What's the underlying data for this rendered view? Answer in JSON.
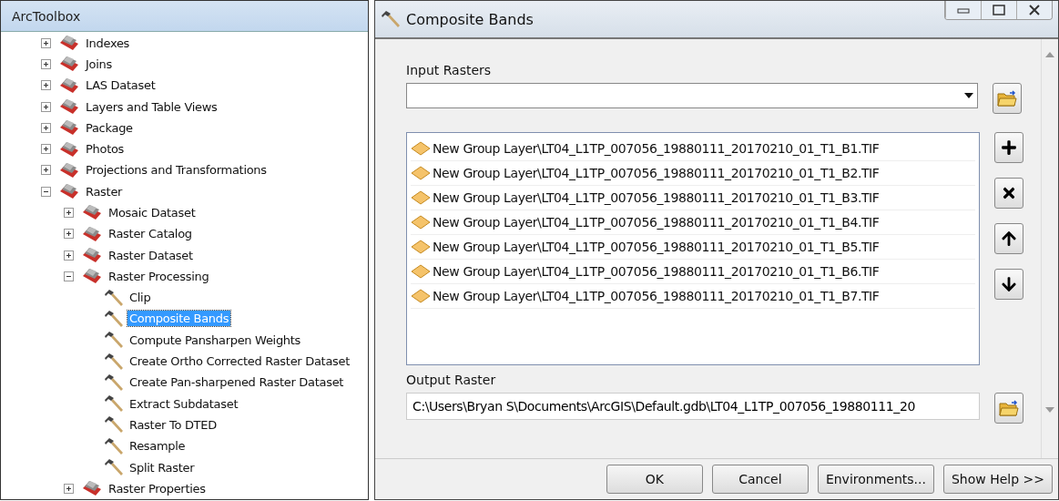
{
  "toolbox": {
    "title": "ArcToolbox",
    "items": [
      {
        "kind": "toolset",
        "label": "Indexes",
        "expanded": false
      },
      {
        "kind": "toolset",
        "label": "Joins",
        "expanded": false
      },
      {
        "kind": "toolset",
        "label": "LAS Dataset",
        "expanded": false
      },
      {
        "kind": "toolset",
        "label": "Layers and Table Views",
        "expanded": false
      },
      {
        "kind": "toolset",
        "label": "Package",
        "expanded": false
      },
      {
        "kind": "toolset",
        "label": "Photos",
        "expanded": false
      },
      {
        "kind": "toolset",
        "label": "Projections and Transformations",
        "expanded": false
      },
      {
        "kind": "toolset",
        "label": "Raster",
        "expanded": true,
        "children": [
          {
            "kind": "toolset",
            "label": "Mosaic Dataset",
            "expanded": false
          },
          {
            "kind": "toolset",
            "label": "Raster Catalog",
            "expanded": false
          },
          {
            "kind": "toolset",
            "label": "Raster Dataset",
            "expanded": false
          },
          {
            "kind": "toolset",
            "label": "Raster Processing",
            "expanded": true,
            "children": [
              {
                "kind": "tool",
                "label": "Clip",
                "selected": false
              },
              {
                "kind": "tool",
                "label": "Composite Bands",
                "selected": true
              },
              {
                "kind": "tool",
                "label": "Compute Pansharpen Weights",
                "selected": false
              },
              {
                "kind": "tool",
                "label": "Create Ortho Corrected Raster Dataset",
                "selected": false
              },
              {
                "kind": "tool",
                "label": "Create Pan-sharpened Raster Dataset",
                "selected": false
              },
              {
                "kind": "tool",
                "label": "Extract Subdataset",
                "selected": false
              },
              {
                "kind": "tool",
                "label": "Raster To DTED",
                "selected": false
              },
              {
                "kind": "tool",
                "label": "Resample",
                "selected": false
              },
              {
                "kind": "tool",
                "label": "Split Raster",
                "selected": false
              }
            ]
          },
          {
            "kind": "toolset",
            "label": "Raster Properties",
            "expanded": false
          }
        ]
      }
    ]
  },
  "dialog": {
    "title": "Composite Bands",
    "input_rasters": {
      "label": "Input Rasters",
      "items": [
        "New Group Layer\\LT04_L1TP_007056_19880111_20170210_01_T1_B1.TIF",
        "New Group Layer\\LT04_L1TP_007056_19880111_20170210_01_T1_B2.TIF",
        "New Group Layer\\LT04_L1TP_007056_19880111_20170210_01_T1_B3.TIF",
        "New Group Layer\\LT04_L1TP_007056_19880111_20170210_01_T1_B4.TIF",
        "New Group Layer\\LT04_L1TP_007056_19880111_20170210_01_T1_B5.TIF",
        "New Group Layer\\LT04_L1TP_007056_19880111_20170210_01_T1_B6.TIF",
        "New Group Layer\\LT04_L1TP_007056_19880111_20170210_01_T1_B7.TIF"
      ]
    },
    "output_raster": {
      "label": "Output Raster",
      "value": "C:\\Users\\Bryan S\\Documents\\ArcGIS\\Default.gdb\\LT04_L1TP_007056_19880111_20"
    },
    "buttons": [
      "OK",
      "Cancel",
      "Environments...",
      "Show Help >>"
    ]
  }
}
